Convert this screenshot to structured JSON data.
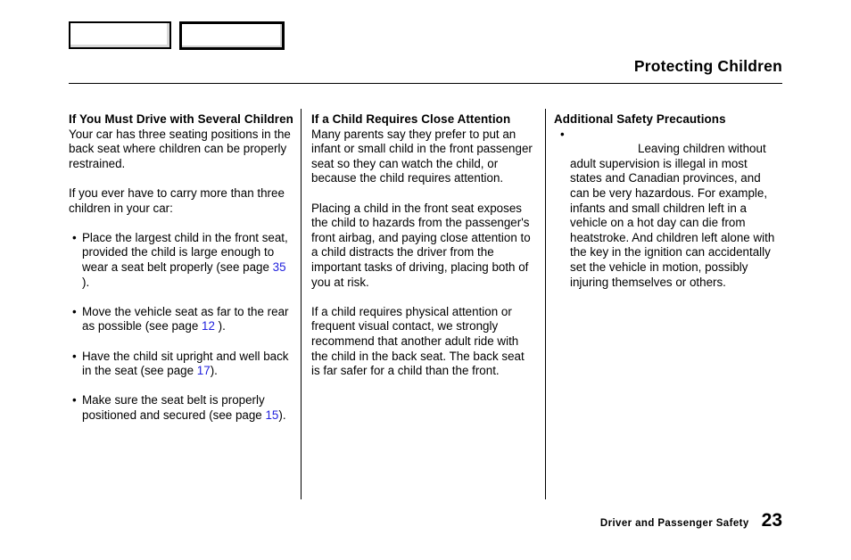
{
  "header": {
    "title": "Protecting Children",
    "nav_boxes": [
      {
        "label": ""
      },
      {
        "label": ""
      }
    ]
  },
  "columns": {
    "col1": {
      "heading": "If You Must Drive with Several Children",
      "paragraphs": [
        "Your car has three seating positions in the back seat where children can be properly restrained.",
        "If you ever have to carry more than three children in your car:"
      ],
      "bullets": [
        {
          "text_before": "Place the largest child in the front seat, provided the child is large enough to wear a seat belt properly (see page ",
          "pageref": "35",
          "text_after": " )."
        },
        {
          "text_before": "Move the vehicle seat as far to the rear as possible (see page ",
          "pageref": "12",
          "text_after": " )."
        },
        {
          "text_before": "Have the child sit upright and well back in the seat (see page ",
          "pageref": "17",
          "text_after": ")."
        },
        {
          "text_before": "Make sure the seat belt is properly positioned and secured (see page ",
          "pageref": "15",
          "text_after": ")."
        }
      ],
      "bullet_marker": "•"
    },
    "col2": {
      "heading": "If a Child Requires Close Attention",
      "paragraphs": [
        "Many parents say they prefer to put an infant or small child in the front passenger seat so they can watch the child, or because the child requires attention.",
        "Placing a child in the front seat exposes the child to hazards from the passenger's front airbag, and paying close attention to a child distracts the driver from the important tasks of driving, placing both of you at risk.",
        "If a child requires physical attention or frequent visual contact, we strongly recommend that another adult ride with the child in the back seat. The back seat is far safer for a child than the front."
      ]
    },
    "col3": {
      "heading": "Additional Safety Precautions",
      "bullet_marker": "•",
      "bullet_text": "Leaving children without adult supervision is illegal in most states and Canadian provinces, and can be very hazardous. For example, infants and small children left in a vehicle on a hot day can die from heatstroke. And children left alone with the key in the ignition can accidentally set the vehicle in motion, possibly injuring themselves or others."
    }
  },
  "footer": {
    "section": "Driver and Passenger Safety",
    "page_number": "23"
  },
  "colors": {
    "pageref_blue": "#2222dd",
    "text": "#000000",
    "background": "#ffffff"
  }
}
